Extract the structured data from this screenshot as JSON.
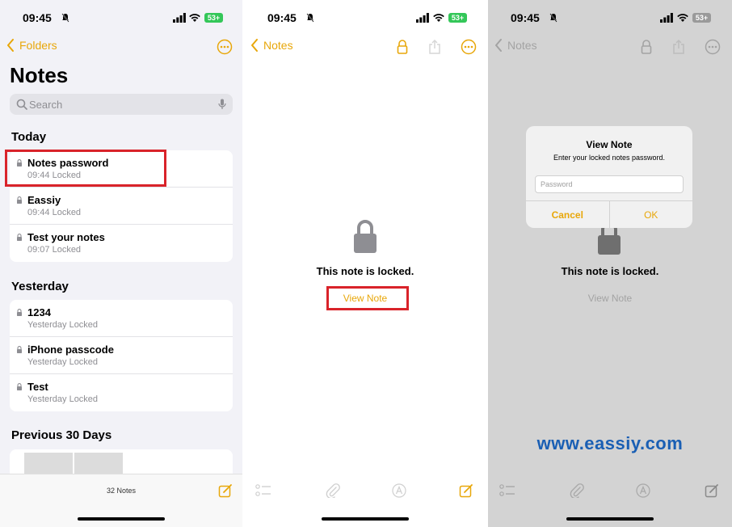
{
  "status": {
    "time": "09:45",
    "battery": "53+"
  },
  "screen1": {
    "back_label": "Folders",
    "title": "Notes",
    "search_placeholder": "Search",
    "sections": [
      {
        "header": "Today",
        "notes": [
          {
            "title": "Notes password",
            "meta": "09:44  Locked"
          },
          {
            "title": "Eassiy",
            "meta": "09:44  Locked"
          },
          {
            "title": "Test your notes",
            "meta": "09:07  Locked"
          }
        ]
      },
      {
        "header": "Yesterday",
        "notes": [
          {
            "title": "1234",
            "meta": "Yesterday  Locked"
          },
          {
            "title": "iPhone passcode",
            "meta": "Yesterday  Locked"
          },
          {
            "title": "Test",
            "meta": "Yesterday  Locked"
          }
        ]
      },
      {
        "header": "Previous 30 Days",
        "notes": []
      }
    ],
    "note_count": "32 Notes"
  },
  "screen2": {
    "back_label": "Notes",
    "locked_text": "This note is locked.",
    "view_note_label": "View Note"
  },
  "screen3": {
    "back_label": "Notes",
    "dialog": {
      "title": "View Note",
      "subtitle": "Enter your locked notes password.",
      "password_placeholder": "Password",
      "cancel_label": "Cancel",
      "ok_label": "OK"
    },
    "locked_text": "This note is locked.",
    "view_note_label": "View Note",
    "watermark": "www.eassiy.com"
  },
  "colors": {
    "accent": "#e8a70a",
    "highlight": "#d9232a",
    "watermark": "#1a5fb4",
    "battery": "#34c759"
  }
}
